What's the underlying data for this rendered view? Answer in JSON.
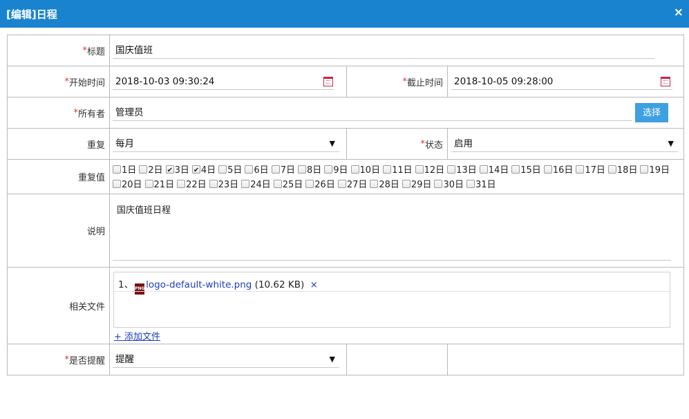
{
  "dialog": {
    "title": "[编辑]日程",
    "close_glyph": "×"
  },
  "required_mark": "*",
  "form": {
    "title": {
      "label": "标题",
      "value": "国庆值班"
    },
    "start_time": {
      "label": "开始时间",
      "value": "2018-10-03 09:30:24"
    },
    "end_time": {
      "label": "截止时间",
      "value": "2018-10-05 09:28:00"
    },
    "owner": {
      "label": "所有者",
      "value": "管理员",
      "select_button": "选择"
    },
    "repeat": {
      "label": "重复",
      "value": "每月"
    },
    "status": {
      "label": "状态",
      "value": "启用"
    },
    "repeat_values": {
      "label": "重复值",
      "days": [
        {
          "label": "1日",
          "checked": false
        },
        {
          "label": "2日",
          "checked": false
        },
        {
          "label": "3日",
          "checked": true
        },
        {
          "label": "4日",
          "checked": true
        },
        {
          "label": "5日",
          "checked": false
        },
        {
          "label": "6日",
          "checked": false
        },
        {
          "label": "7日",
          "checked": false
        },
        {
          "label": "8日",
          "checked": false
        },
        {
          "label": "9日",
          "checked": false
        },
        {
          "label": "10日",
          "checked": false
        },
        {
          "label": "11日",
          "checked": false
        },
        {
          "label": "12日",
          "checked": false
        },
        {
          "label": "13日",
          "checked": false
        },
        {
          "label": "14日",
          "checked": false
        },
        {
          "label": "15日",
          "checked": false
        },
        {
          "label": "16日",
          "checked": false
        },
        {
          "label": "17日",
          "checked": false
        },
        {
          "label": "18日",
          "checked": false
        },
        {
          "label": "19日",
          "checked": false
        },
        {
          "label": "20日",
          "checked": false
        },
        {
          "label": "21日",
          "checked": false
        },
        {
          "label": "22日",
          "checked": false
        },
        {
          "label": "23日",
          "checked": false
        },
        {
          "label": "24日",
          "checked": false
        },
        {
          "label": "25日",
          "checked": false
        },
        {
          "label": "26日",
          "checked": false
        },
        {
          "label": "27日",
          "checked": false
        },
        {
          "label": "28日",
          "checked": false
        },
        {
          "label": "29日",
          "checked": false
        },
        {
          "label": "30日",
          "checked": false
        },
        {
          "label": "31日",
          "checked": false
        }
      ]
    },
    "description": {
      "label": "说明",
      "value": "国庆值班日程"
    },
    "files": {
      "label": "相关文件",
      "items": [
        {
          "index": "1、",
          "icon_text": "PNG",
          "name": "logo-default-white.png",
          "size": "(10.62 KB)",
          "remove": "×"
        }
      ],
      "add_label": "+ 添加文件"
    },
    "remind": {
      "label": "是否提醒",
      "value": "提醒"
    }
  },
  "icons": {
    "calendar": "calendar-icon",
    "dropdown": "▼"
  }
}
